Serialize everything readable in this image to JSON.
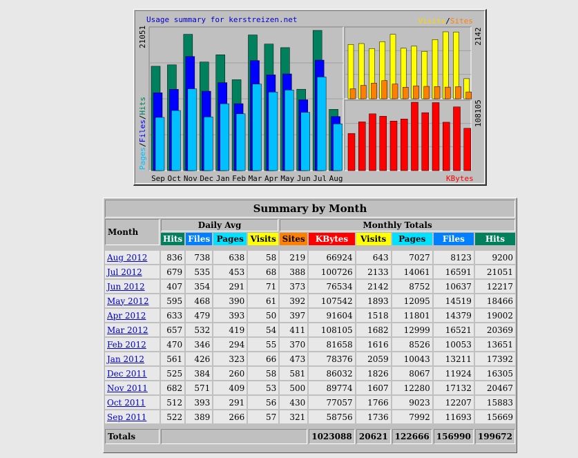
{
  "graph": {
    "title": "Usage summary for kerstreizen.net",
    "legend_visits": "Visits",
    "legend_slash": "/",
    "legend_sites": "Sites",
    "left_axis": {
      "pages": "Pages",
      "files": "Files",
      "hits": "Hits",
      "sep": "/"
    },
    "left_max": "21051",
    "right_top_max": "2142",
    "right_bottom_max": "108105",
    "kbytes_label": "KBytes",
    "months": [
      "Sep",
      "Oct",
      "Nov",
      "Dec",
      "Jan",
      "Feb",
      "Mar",
      "Apr",
      "May",
      "Jun",
      "Jul",
      "Aug"
    ],
    "colors": {
      "hits": "#00805c",
      "files": "#0000ff",
      "pages": "#00c0ff",
      "visits": "#ffff00",
      "sites": "#ff8000",
      "kbytes": "#ff0000",
      "title": "#0000cc"
    }
  },
  "chart_data": {
    "type": "bar",
    "categories": [
      "Sep 2011",
      "Oct 2011",
      "Nov 2011",
      "Dec 2011",
      "Jan 2012",
      "Feb 2012",
      "Mar 2012",
      "Apr 2012",
      "May 2012",
      "Jun 2012",
      "Jul 2012",
      "Aug 2012"
    ],
    "series": [
      {
        "name": "Hits",
        "values": [
          15669,
          15883,
          20467,
          16305,
          17392,
          13651,
          20369,
          19002,
          18466,
          12217,
          21051,
          9200
        ]
      },
      {
        "name": "Files",
        "values": [
          11693,
          12207,
          17132,
          11924,
          13211,
          10053,
          16521,
          14379,
          14519,
          10637,
          16591,
          8123
        ]
      },
      {
        "name": "Pages",
        "values": [
          7992,
          9023,
          12280,
          8067,
          10043,
          8526,
          12999,
          11801,
          12095,
          8752,
          14061,
          7027
        ]
      },
      {
        "name": "Visits",
        "values": [
          1736,
          1766,
          1607,
          1826,
          2059,
          1616,
          1682,
          1518,
          1893,
          2142,
          2133,
          643
        ]
      },
      {
        "name": "Sites",
        "values": [
          321,
          430,
          500,
          581,
          473,
          370,
          411,
          397,
          392,
          373,
          388,
          219
        ]
      },
      {
        "name": "KBytes",
        "values": [
          58756,
          77057,
          89774,
          86032,
          78376,
          81658,
          108105,
          91604,
          107542,
          76534,
          100726,
          66924
        ]
      }
    ]
  },
  "summary": {
    "caption": "Summary by Month",
    "month_header": "Month",
    "daily_avg_header": "Daily Avg",
    "monthly_totals_header": "Monthly Totals",
    "daily_cols": [
      "Hits",
      "Files",
      "Pages",
      "Visits"
    ],
    "monthly_cols": [
      "Sites",
      "KBytes",
      "Visits",
      "Pages",
      "Files",
      "Hits"
    ],
    "rows": [
      {
        "month": "Aug 2012",
        "d": [
          "836",
          "738",
          "638",
          "58"
        ],
        "m": [
          "219",
          "66924",
          "643",
          "7027",
          "8123",
          "9200"
        ]
      },
      {
        "month": "Jul 2012",
        "d": [
          "679",
          "535",
          "453",
          "68"
        ],
        "m": [
          "388",
          "100726",
          "2133",
          "14061",
          "16591",
          "21051"
        ]
      },
      {
        "month": "Jun 2012",
        "d": [
          "407",
          "354",
          "291",
          "71"
        ],
        "m": [
          "373",
          "76534",
          "2142",
          "8752",
          "10637",
          "12217"
        ]
      },
      {
        "month": "May 2012",
        "d": [
          "595",
          "468",
          "390",
          "61"
        ],
        "m": [
          "392",
          "107542",
          "1893",
          "12095",
          "14519",
          "18466"
        ]
      },
      {
        "month": "Apr 2012",
        "d": [
          "633",
          "479",
          "393",
          "50"
        ],
        "m": [
          "397",
          "91604",
          "1518",
          "11801",
          "14379",
          "19002"
        ]
      },
      {
        "month": "Mar 2012",
        "d": [
          "657",
          "532",
          "419",
          "54"
        ],
        "m": [
          "411",
          "108105",
          "1682",
          "12999",
          "16521",
          "20369"
        ]
      },
      {
        "month": "Feb 2012",
        "d": [
          "470",
          "346",
          "294",
          "55"
        ],
        "m": [
          "370",
          "81658",
          "1616",
          "8526",
          "10053",
          "13651"
        ]
      },
      {
        "month": "Jan 2012",
        "d": [
          "561",
          "426",
          "323",
          "66"
        ],
        "m": [
          "473",
          "78376",
          "2059",
          "10043",
          "13211",
          "17392"
        ]
      },
      {
        "month": "Dec 2011",
        "d": [
          "525",
          "384",
          "260",
          "58"
        ],
        "m": [
          "581",
          "86032",
          "1826",
          "8067",
          "11924",
          "16305"
        ]
      },
      {
        "month": "Nov 2011",
        "d": [
          "682",
          "571",
          "409",
          "53"
        ],
        "m": [
          "500",
          "89774",
          "1607",
          "12280",
          "17132",
          "20467"
        ]
      },
      {
        "month": "Oct 2011",
        "d": [
          "512",
          "393",
          "291",
          "56"
        ],
        "m": [
          "430",
          "77057",
          "1766",
          "9023",
          "12207",
          "15883"
        ]
      },
      {
        "month": "Sep 2011",
        "d": [
          "522",
          "389",
          "266",
          "57"
        ],
        "m": [
          "321",
          "58756",
          "1736",
          "7992",
          "11693",
          "15669"
        ]
      }
    ],
    "totals": {
      "label": "Totals",
      "kbytes": "1023088",
      "visits": "20621",
      "pages": "122666",
      "files": "156990",
      "hits": "199672"
    }
  }
}
